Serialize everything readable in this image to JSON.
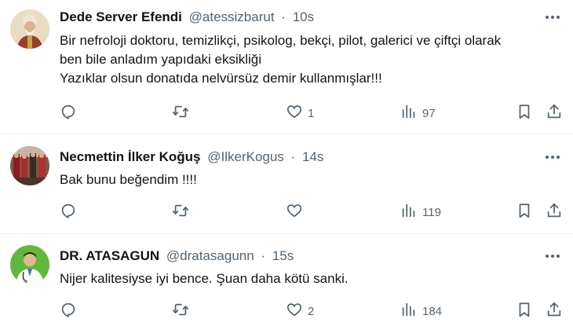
{
  "tweets": [
    {
      "name": "Dede Server Efendi",
      "handle": "@atessizbarut",
      "sep": "·",
      "time": "10s",
      "lines": [
        "Bir nefroloji doktoru, temizlikçi, psikolog, bekçi, pilot, galerici ve çiftçi olarak",
        "ben bile anladım yapıdaki eksikliği",
        "Yazıklar olsun donatıda nelvürsüz demir kullanmışlar!!!"
      ],
      "replies": "",
      "reposts": "",
      "likes": "1",
      "views": "97"
    },
    {
      "name": "Necmettin İlker Koğuş",
      "handle": "@IlkerKogus",
      "sep": "·",
      "time": "14s",
      "lines": [
        "Bak bunu beğendim  !!!!"
      ],
      "replies": "",
      "reposts": "",
      "likes": "",
      "views": "119"
    },
    {
      "name": "DR. ATASAGUN",
      "handle": "@dratasagunn",
      "sep": "·",
      "time": "15s",
      "lines": [
        "Nijer kalitesiyse iyi bence. Şuan daha kötü sanki."
      ],
      "replies": "",
      "reposts": "",
      "likes": "2",
      "views": "184"
    }
  ],
  "icons": {
    "reply": "reply-icon",
    "repost": "repost-icon",
    "like": "heart-icon",
    "views": "views-icon",
    "bookmark": "bookmark-icon",
    "share": "share-icon",
    "more": "more-icon"
  },
  "colors": {
    "text": "#0f1419",
    "secondary": "#536471",
    "divider": "#eff3f4"
  }
}
